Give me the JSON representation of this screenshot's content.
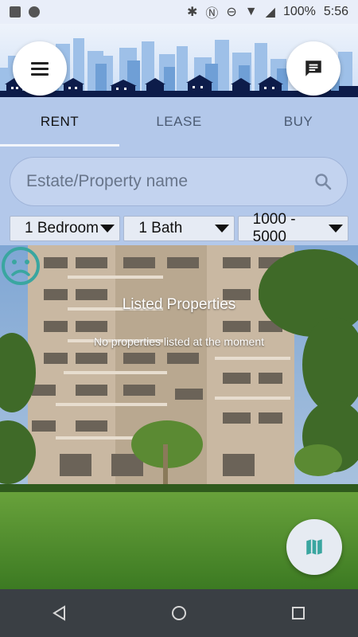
{
  "status_bar": {
    "battery": "100%",
    "time": "5:56"
  },
  "header": {
    "menu_icon": "menu-icon",
    "chat_icon": "message-icon"
  },
  "tabs": [
    {
      "label": "RENT",
      "active": true
    },
    {
      "label": "LEASE",
      "active": false
    },
    {
      "label": "BUY",
      "active": false
    }
  ],
  "search": {
    "placeholder": "Estate/Property name",
    "value": ""
  },
  "filters": {
    "bedrooms": "1 Bedroom",
    "baths": "1 Bath",
    "price": "1000 - 5000"
  },
  "empty_state": {
    "icon": "sad-face-icon",
    "title": "Listed Properties",
    "message": "No properties listed at the moment"
  },
  "fab": {
    "icon": "map-icon"
  },
  "colors": {
    "accent": "#3aa6a0",
    "header_bg": "#b3c8ea",
    "navbar_bg": "#3a3f44"
  }
}
